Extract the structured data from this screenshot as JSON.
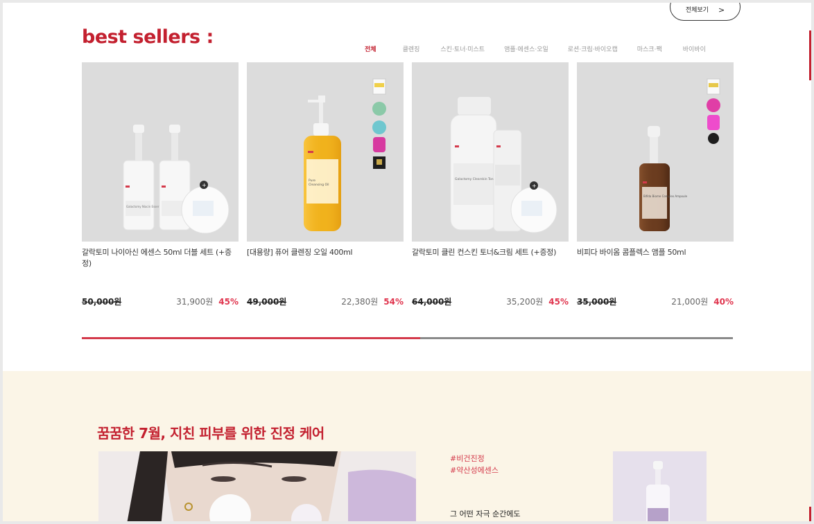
{
  "header": {
    "more_label": "전체보기",
    "more_chevron": ">"
  },
  "section_title": "best sellers :",
  "tabs": [
    "전체",
    "클렌징",
    "스킨·토너·미스트",
    "앰플·에센스·오일",
    "로션·크림·바이오캡",
    "마스크·팩",
    "바이바이"
  ],
  "active_tab": 0,
  "products": [
    {
      "name": "갈락토미 나이아신 에센스 50ml 더블 세트 (+증정)",
      "original_price": "50,000원",
      "sale_price": "31,900원",
      "discount": "45%"
    },
    {
      "name": "[대용량] 퓨어 클렌징 오일 400ml",
      "original_price": "49,000원",
      "sale_price": "22,380원",
      "discount": "54%"
    },
    {
      "name": "갈락토미 클린 컨스킨 토너&크림 세트 (+증정)",
      "original_price": "64,000원",
      "sale_price": "35,200원",
      "discount": "45%"
    },
    {
      "name": "비피다 바이옴 콤플렉스 앰플 50ml",
      "original_price": "35,000원",
      "sale_price": "21,000원",
      "discount": "40%"
    }
  ],
  "product_labels": {
    "niacin": "Galactomy Niacin Essence",
    "oil_a": "Pure",
    "oil_b": "Cleansing Oil",
    "toner": "Galactomy Clearskin Toner",
    "bifida": "Bifida Biome Complex Ampoule"
  },
  "carousel_progress": 0.52,
  "promo": {
    "title": "꿈꿈한 7월, 지친 피부를 위한 진정 케어",
    "tags": [
      "#비건진정",
      "#약산성에센스"
    ],
    "subtitle": "그 어떤 자극 순간에도"
  },
  "colors": {
    "accent": "#c3202f",
    "discount": "#e0354e",
    "thumb_bg": "#dcdcdc",
    "promo_bg": "#fbf5e7"
  }
}
